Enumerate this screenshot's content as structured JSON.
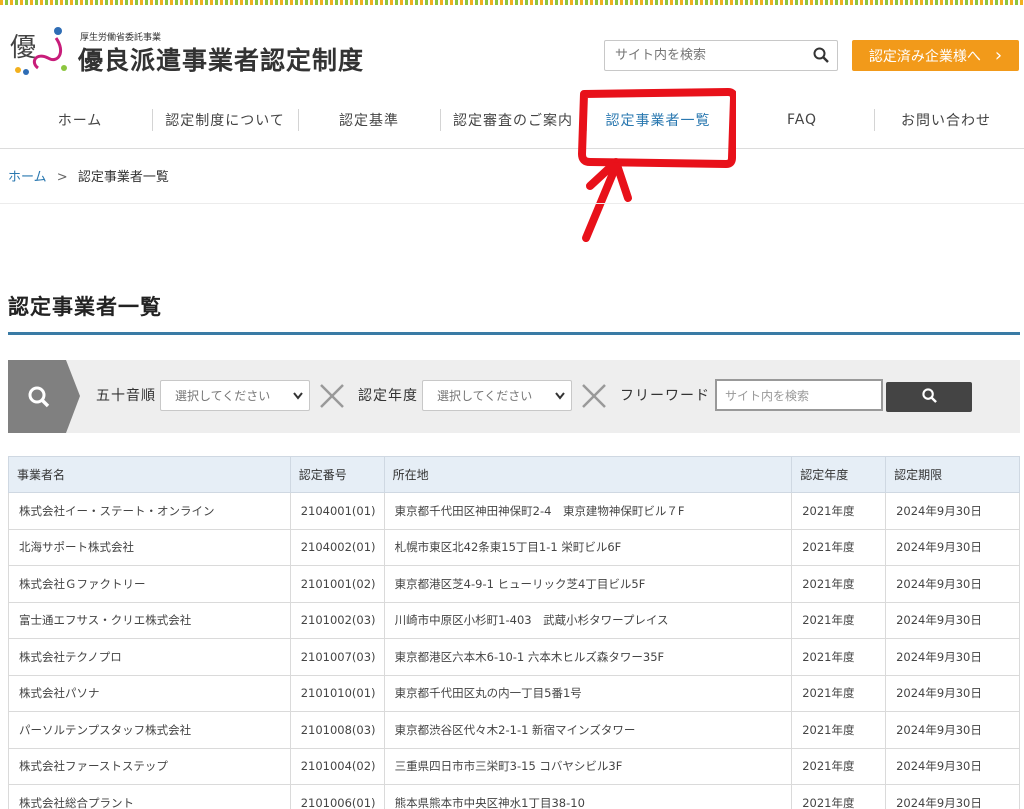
{
  "header": {
    "logo_kanji": "優",
    "logo_subtitle": "厚生労働省委託事業",
    "logo_title": "優良派遣事業者認定制度",
    "search_placeholder": "サイト内を検索",
    "cert_button": "認定済み企業様へ",
    "cert_button_arrow": "›"
  },
  "nav": {
    "items": [
      {
        "label": "ホーム"
      },
      {
        "label": "認定制度について"
      },
      {
        "label": "認定基準"
      },
      {
        "label": "認定審査のご案内"
      },
      {
        "label": "認定事業者一覧"
      },
      {
        "label": "FAQ"
      },
      {
        "label": "お問い合わせ"
      }
    ],
    "active_index": 4
  },
  "breadcrumb": {
    "home": "ホーム",
    "separator": ">",
    "current": "認定事業者一覧"
  },
  "page": {
    "title": "認定事業者一覧"
  },
  "filter": {
    "label_syllabary": "五十音順",
    "select_syllabary": "選択してください",
    "label_year": "認定年度",
    "select_year": "選択してください",
    "label_freeword": "フリーワード",
    "freeword_placeholder": "サイト内を検索"
  },
  "table": {
    "headers": [
      "事業者名",
      "認定番号",
      "所在地",
      "認定年度",
      "認定期限"
    ],
    "rows": [
      [
        "株式会社イー・ステート・オンライン",
        "2104001(01)",
        "東京都千代田区神田神保町2-4　東京建物神保町ビル７F",
        "2021年度",
        "2024年9月30日"
      ],
      [
        "北海サポート株式会社",
        "2104002(01)",
        "札幌市東区北42条東15丁目1-1 栄町ビル6F",
        "2021年度",
        "2024年9月30日"
      ],
      [
        "株式会社Ｇファクトリー",
        "2101001(02)",
        "東京都港区芝4-9-1 ヒューリック芝4丁目ビル5F",
        "2021年度",
        "2024年9月30日"
      ],
      [
        "富士通エフサス・クリエ株式会社",
        "2101002(03)",
        "川崎市中原区小杉町1-403　武蔵小杉タワープレイス",
        "2021年度",
        "2024年9月30日"
      ],
      [
        "株式会社テクノプロ",
        "2101007(03)",
        "東京都港区六本木6-10-1 六本木ヒルズ森タワー35F",
        "2021年度",
        "2024年9月30日"
      ],
      [
        "株式会社パソナ",
        "2101010(01)",
        "東京都千代田区丸の内一丁目5番1号",
        "2021年度",
        "2024年9月30日"
      ],
      [
        "パーソルテンプスタッフ株式会社",
        "2101008(03)",
        "東京都渋谷区代々木2-1-1 新宿マインズタワー",
        "2021年度",
        "2024年9月30日"
      ],
      [
        "株式会社ファーストステップ",
        "2101004(02)",
        "三重県四日市市三栄町3-15 コバヤシビル3F",
        "2021年度",
        "2024年9月30日"
      ],
      [
        "株式会社総合プラント",
        "2101006(01)",
        "熊本県熊本市中央区神水1丁目38-10",
        "2021年度",
        "2024年9月30日"
      ]
    ]
  },
  "colors": {
    "accent_blue": "#3a7ba5",
    "orange": "#f29a1a",
    "annotation_red": "#e8111a"
  },
  "icons": {
    "search": "search-icon",
    "close_x": "close-x-icon",
    "chevron": "chevron-right-icon"
  }
}
